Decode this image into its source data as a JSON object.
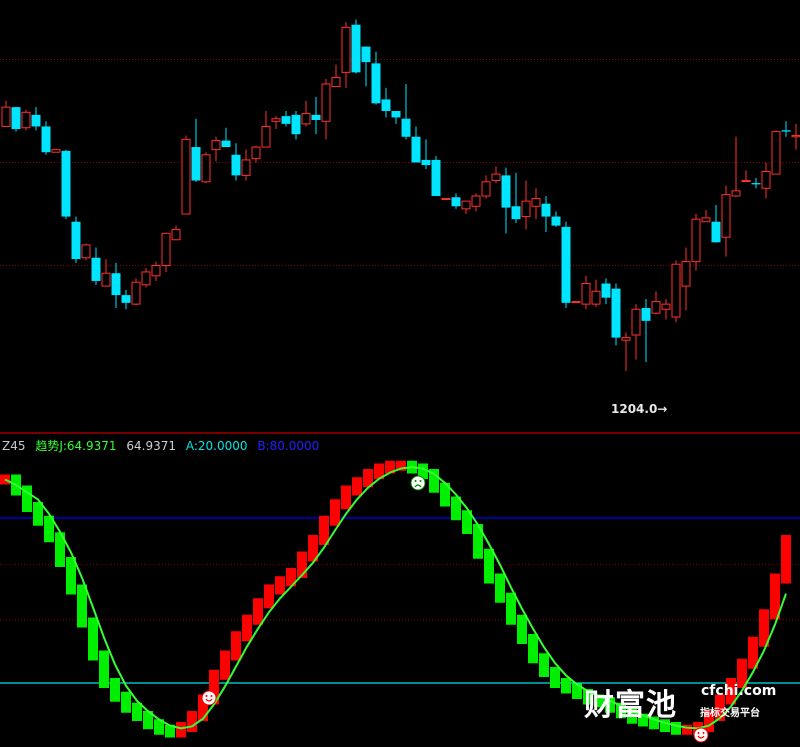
{
  "indicator": {
    "name": "Z45",
    "trend_label": "趋势J:64.9371",
    "j_value": "64.9371",
    "a_label": "A:20.0000",
    "b_label": "B:80.0000"
  },
  "price_marker": "1204.0→",
  "watermark": {
    "brand": "财富池",
    "url": "cfchi.com",
    "tagline": "指标交易平台"
  },
  "colors": {
    "up": "#ff3030",
    "down": "#00e5ff",
    "bar_up": "#ff0000",
    "bar_down": "#00ee00",
    "trend_line": "#33ff33",
    "level_a": "#00e5e5",
    "level_b": "#0000ff",
    "grid": "#8b0000"
  },
  "chart_data": [
    {
      "type": "candlestick",
      "title": "",
      "series": [
        {
          "name": "OHLC",
          "values": [
            [
              1428,
              1443,
              1448,
              1432
            ],
            [
              1443,
              1426,
              1443,
              1424
            ],
            [
              1427,
              1439,
              1441,
              1425
            ],
            [
              1437,
              1428,
              1443,
              1425
            ],
            [
              1428,
              1408,
              1432,
              1406
            ],
            [
              1408,
              1410,
              1410,
              1408
            ],
            [
              1409,
              1358,
              1410,
              1356
            ],
            [
              1354,
              1325,
              1358,
              1322
            ],
            [
              1326,
              1336,
              1337,
              1324
            ],
            [
              1326,
              1308,
              1334,
              1305
            ],
            [
              1304,
              1314,
              1325,
              1304
            ],
            [
              1314,
              1297,
              1322,
              1287
            ],
            [
              1297,
              1291,
              1301,
              1286
            ],
            [
              1290,
              1307,
              1310,
              1289
            ],
            [
              1305,
              1315,
              1318,
              1303
            ],
            [
              1312,
              1320,
              1323,
              1308
            ],
            [
              1320,
              1345,
              1345,
              1315
            ],
            [
              1340,
              1348,
              1351,
              1340
            ],
            [
              1360,
              1418,
              1421,
              1360
            ],
            [
              1412,
              1386,
              1434,
              1385
            ],
            [
              1385,
              1406,
              1408,
              1384
            ],
            [
              1410,
              1417,
              1420,
              1401
            ],
            [
              1417,
              1412,
              1427,
              1412
            ],
            [
              1406,
              1390,
              1415,
              1386
            ],
            [
              1390,
              1402,
              1410,
              1386
            ],
            [
              1403,
              1412,
              1413,
              1400
            ],
            [
              1412,
              1428,
              1440,
              1412
            ],
            [
              1432,
              1434,
              1436,
              1426
            ],
            [
              1436,
              1430,
              1440,
              1428
            ],
            [
              1437,
              1422,
              1440,
              1418
            ],
            [
              1430,
              1438,
              1448,
              1428
            ],
            [
              1437,
              1433,
              1451,
              1422
            ],
            [
              1432,
              1461,
              1465,
              1418
            ],
            [
              1459,
              1466,
              1476,
              1462
            ],
            [
              1470,
              1505,
              1509,
              1458
            ],
            [
              1507,
              1470,
              1511,
              1469
            ],
            [
              1490,
              1478,
              1490,
              1459
            ],
            [
              1477,
              1446,
              1486,
              1445
            ],
            [
              1449,
              1440,
              1458,
              1435
            ],
            [
              1440,
              1435,
              1440,
              1430
            ],
            [
              1434,
              1420,
              1461,
              1418
            ],
            [
              1420,
              1400,
              1428,
              1400
            ],
            [
              1402,
              1398,
              1418,
              1395
            ],
            [
              1402,
              1374,
              1405,
              1374
            ],
            [
              1372,
              1372,
              1372,
              1372
            ],
            [
              1373,
              1366,
              1376,
              1364
            ],
            [
              1364,
              1370,
              1370,
              1360
            ],
            [
              1366,
              1374,
              1376,
              1362
            ],
            [
              1374,
              1385,
              1390,
              1372
            ],
            [
              1386,
              1391,
              1397,
              1384
            ],
            [
              1390,
              1365,
              1396,
              1345
            ],
            [
              1366,
              1356,
              1392,
              1353
            ],
            [
              1358,
              1370,
              1386,
              1348
            ],
            [
              1366,
              1372,
              1380,
              1356
            ],
            [
              1368,
              1358,
              1374,
              1346
            ],
            [
              1358,
              1351,
              1362,
              1350
            ],
            [
              1350,
              1291,
              1354,
              1287
            ],
            [
              1292,
              1292,
              1292,
              1292
            ],
            [
              1290,
              1306,
              1312,
              1286
            ],
            [
              1290,
              1300,
              1309,
              1288
            ],
            [
              1306,
              1295,
              1310,
              1290
            ],
            [
              1302,
              1264,
              1306,
              1258
            ],
            [
              1262,
              1264,
              1268,
              1238
            ],
            [
              1266,
              1286,
              1290,
              1247
            ],
            [
              1287,
              1277,
              1294,
              1245
            ],
            [
              1283,
              1292,
              1300,
              1282
            ],
            [
              1286,
              1290,
              1294,
              1278
            ],
            [
              1280,
              1321,
              1324,
              1276
            ],
            [
              1304,
              1323,
              1334,
              1285
            ],
            [
              1323,
              1356,
              1360,
              1316
            ],
            [
              1354,
              1357,
              1363,
              1354
            ],
            [
              1354,
              1338,
              1367,
              1338
            ],
            [
              1342,
              1375,
              1382,
              1327
            ],
            [
              1374,
              1378,
              1420,
              1373
            ],
            [
              1386,
              1386,
              1394,
              1386
            ],
            [
              1384,
              1383,
              1388,
              1380
            ],
            [
              1380,
              1393,
              1400,
              1372
            ],
            [
              1391,
              1424,
              1425,
              1391
            ],
            [
              1425,
              1424,
              1432,
              1420
            ],
            [
              1420,
              1421,
              1430,
              1410
            ]
          ]
        }
      ],
      "annotations": [
        "1204.0"
      ]
    },
    {
      "type": "bar",
      "title": "Z45",
      "series": [
        {
          "name": "趋势J",
          "values": [
            94,
            90,
            84,
            79,
            73,
            64,
            54,
            42,
            30,
            20,
            15,
            11,
            8,
            5,
            3,
            2,
            4,
            8,
            14,
            23,
            30,
            37,
            43,
            49,
            54,
            57,
            60,
            66,
            72,
            79,
            85,
            90,
            93,
            96,
            98,
            99,
            99,
            98,
            96,
            91,
            86,
            81,
            76,
            67,
            58,
            51,
            43,
            36,
            29,
            24,
            20,
            18,
            16,
            14,
            13,
            11,
            9,
            7,
            6,
            5,
            4,
            3,
            3,
            4,
            8,
            14,
            20,
            27,
            35,
            45,
            58,
            72
          ]
        },
        {
          "name": "A",
          "values": [
            20
          ]
        },
        {
          "name": "B",
          "values": [
            80
          ]
        }
      ],
      "ylim": [
        0,
        100
      ]
    }
  ]
}
